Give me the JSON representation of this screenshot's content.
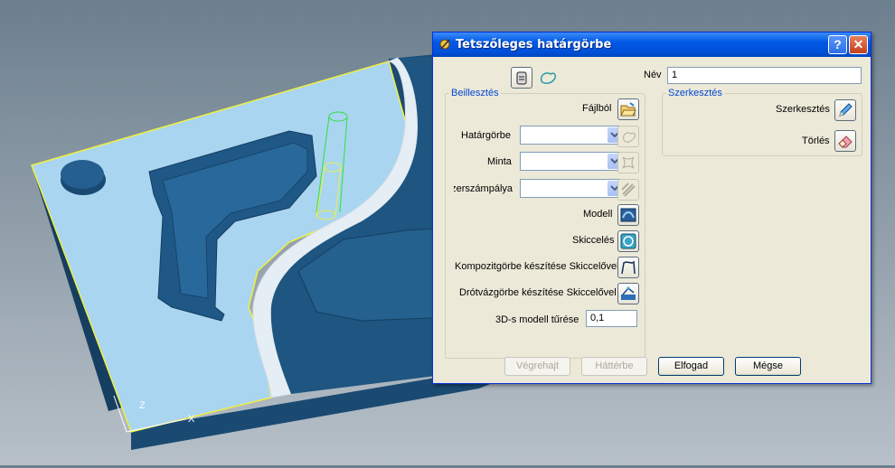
{
  "dialog": {
    "title": "Tetszőleges határgörbe",
    "help_label": "?",
    "close_label": "✕",
    "name_label": "Név",
    "name_value": "1",
    "insert_group": {
      "legend": "Beillesztés",
      "from_file": "Fájlból",
      "boundary": "Határgörbe",
      "pattern": "Minta",
      "toolpath": "zerszámpálya",
      "model": "Modell",
      "sketch": "Skiccelés",
      "composite_sketch": "Kompozitgörbe készítése Skiccelővel",
      "wireframe_sketch": "Drótvázgörbe készítése Skiccelővel",
      "tolerance_label": "3D-s modell tűrése",
      "tolerance_value": "0,1"
    },
    "edit_group": {
      "legend": "Szerkesztés",
      "edit": "Szerkesztés",
      "delete": "Törlés"
    },
    "buttons": {
      "apply": "Végrehajt",
      "background": "Háttérbe",
      "accept": "Elfogad",
      "cancel": "Mégse"
    }
  },
  "viewport": {
    "axis_z": "Z",
    "axis_x": "X"
  },
  "colors": {
    "title_bar": "#0058e6",
    "dialog_bg": "#ece9d8",
    "group_legend": "#0046d5",
    "part_base": "#1d4f78",
    "part_face": "#a8d4f0",
    "wire_yellow": "#e8f040",
    "wire_green": "#30e040"
  }
}
